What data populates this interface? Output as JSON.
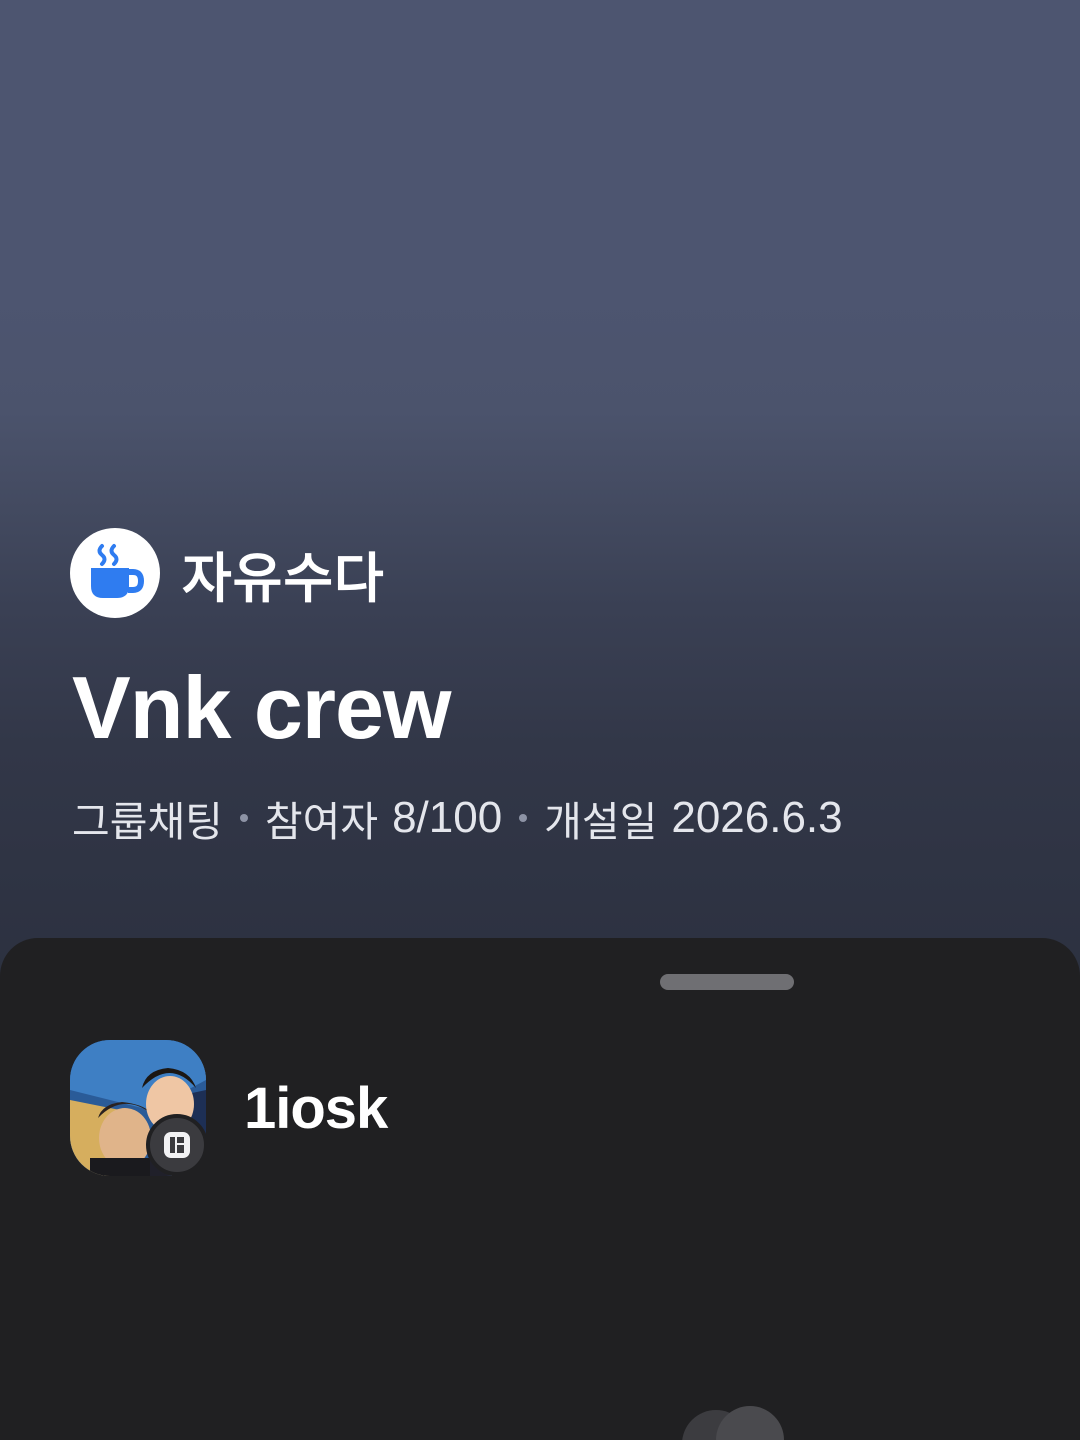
{
  "room": {
    "category_icon": "coffee-cup-icon",
    "category_label": "자유수다",
    "title": "Vnk crew",
    "meta": {
      "type_label": "그룹채팅",
      "participants_label": "참여자",
      "participants_value": "8/100",
      "created_label": "개설일",
      "created_value": "2026.6.3"
    }
  },
  "members": [
    {
      "name": "1iosk",
      "badge_icon": "host-badge-icon"
    }
  ],
  "colors": {
    "header_top": "#4d5570",
    "header_bottom": "#2c3140",
    "sheet_bg": "#202022",
    "category_icon_accent": "#2f7cf0",
    "handle": "#6f6f73"
  }
}
